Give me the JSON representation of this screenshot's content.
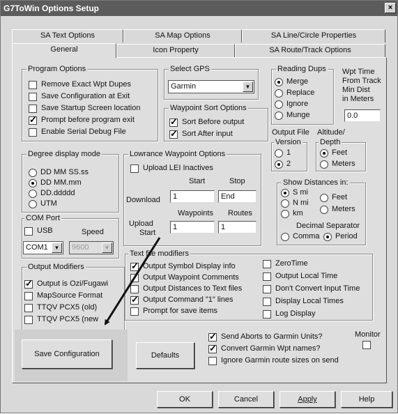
{
  "window": {
    "title": "G7ToWin Options Setup",
    "close_glyph": "×"
  },
  "tabs_back": [
    "SA Text Options",
    "SA Map Options",
    "SA Line/Circle Properties"
  ],
  "tabs_front": [
    "General",
    "Icon Property",
    "SA Route/Track Options"
  ],
  "program_options": {
    "title": "Program Options",
    "items": [
      {
        "label": "Remove Exact Wpt Dupes",
        "checked": false
      },
      {
        "label": "Save Configuration at Exit",
        "checked": false
      },
      {
        "label": "Save Startup Screen location",
        "checked": false
      },
      {
        "label": "Prompt before program exit",
        "checked": true
      },
      {
        "label": "Enable Serial Debug File",
        "checked": false
      }
    ]
  },
  "select_gps": {
    "title": "Select GPS",
    "value": "Garmin"
  },
  "waypoint_sort": {
    "title": "Waypoint Sort Options",
    "items": [
      {
        "label": "Sort Before output",
        "checked": true
      },
      {
        "label": "Sort After input",
        "checked": true
      }
    ]
  },
  "reading_dups": {
    "title": "Reading Dups",
    "options": [
      {
        "label": "Merge",
        "checked": true
      },
      {
        "label": "Replace",
        "checked": false
      },
      {
        "label": "Ignore",
        "checked": false
      },
      {
        "label": "Munge",
        "checked": false
      }
    ]
  },
  "wpt_time": {
    "lines": [
      "Wpt Time",
      "From Track",
      "Min Dist",
      "in Meters"
    ],
    "value": "0.0"
  },
  "output_file_version": {
    "caption": "Output File",
    "title": "Version",
    "options": [
      {
        "label": "1",
        "checked": false
      },
      {
        "label": "2",
        "checked": true
      }
    ]
  },
  "altitude_depth": {
    "caption": "Altitude/",
    "title": "Depth",
    "options": [
      {
        "label": "Feet",
        "checked": true
      },
      {
        "label": "Meters",
        "checked": false
      }
    ]
  },
  "degree_display": {
    "title": "Degree display mode",
    "options": [
      {
        "label": "DD MM SS.ss",
        "checked": false
      },
      {
        "label": "DD MM.mm",
        "checked": true
      },
      {
        "label": "DD.ddddd",
        "checked": false
      },
      {
        "label": "UTM",
        "checked": false
      }
    ]
  },
  "lowrance": {
    "title": "Lowrance Waypoint Options",
    "upload_lei": {
      "label": "Upload LEI Inactives",
      "checked": false
    },
    "start_header": "Start",
    "stop_header": "Stop",
    "download_label": "Download",
    "download_start": "1",
    "download_stop": "End",
    "waypoints_header": "Waypoints",
    "routes_header": "Routes",
    "upload_label_1": "Upload",
    "upload_label_2": "Start",
    "upload_waypoints": "1",
    "upload_routes": "1"
  },
  "show_distances": {
    "title": "Show Distances in:",
    "options": [
      {
        "label": "S mi",
        "checked": true
      },
      {
        "label": "N mi",
        "checked": false
      },
      {
        "label": "km",
        "checked": false
      },
      {
        "label": "Feet",
        "checked": false
      },
      {
        "label": "Meters",
        "checked": false
      }
    ],
    "decimal_label": "Decimal Separator",
    "separator": [
      {
        "label": "Comma",
        "checked": false
      },
      {
        "label": "Period",
        "checked": true
      }
    ]
  },
  "com_port": {
    "title": "COM Port",
    "usb": {
      "label": "USB",
      "checked": false
    },
    "speed_label": "Speed",
    "port_value": "COM1",
    "speed_value": "9600"
  },
  "output_modifiers": {
    "title": "Output Modifiers",
    "items": [
      {
        "label": "Output is Ozi/Fugawi",
        "checked": true
      },
      {
        "label": "MapSource Format",
        "checked": false
      },
      {
        "label": "TTQV PCX5 (old)",
        "checked": false
      },
      {
        "label": "TTQV PCX5 (new",
        "checked": false
      }
    ]
  },
  "text_file_modifiers": {
    "title": "Text file modifiers",
    "left": [
      {
        "label": "Output Symbol Display info",
        "checked": true
      },
      {
        "label": "Output Waypoint Comments",
        "checked": false
      },
      {
        "label": "Output Distances to Text files",
        "checked": false
      },
      {
        "label": "Output Command \"1\" lines",
        "checked": true
      },
      {
        "label": "Prompt for save items",
        "checked": false
      }
    ],
    "right": [
      {
        "label": "ZeroTime",
        "checked": false
      },
      {
        "label": "Output Local Time",
        "checked": false
      },
      {
        "label": "Don't Convert Input Time",
        "checked": false
      },
      {
        "label": "Display Local Times",
        "checked": false
      },
      {
        "label": "Log Display",
        "checked": false
      }
    ]
  },
  "garmin_options": [
    {
      "label": "Send Aborts to Garmin Units?",
      "checked": true
    },
    {
      "label": "Convert Garmin Wpt names?",
      "checked": true
    },
    {
      "label": "Ignore Garmin route sizes on send",
      "checked": false
    }
  ],
  "monitor": {
    "label": "Monitor",
    "checked": false
  },
  "buttons": {
    "save_configuration": "Save Configuration",
    "defaults": "Defaults",
    "ok": "OK",
    "cancel": "Cancel",
    "apply": "Apply",
    "help": "Help"
  }
}
